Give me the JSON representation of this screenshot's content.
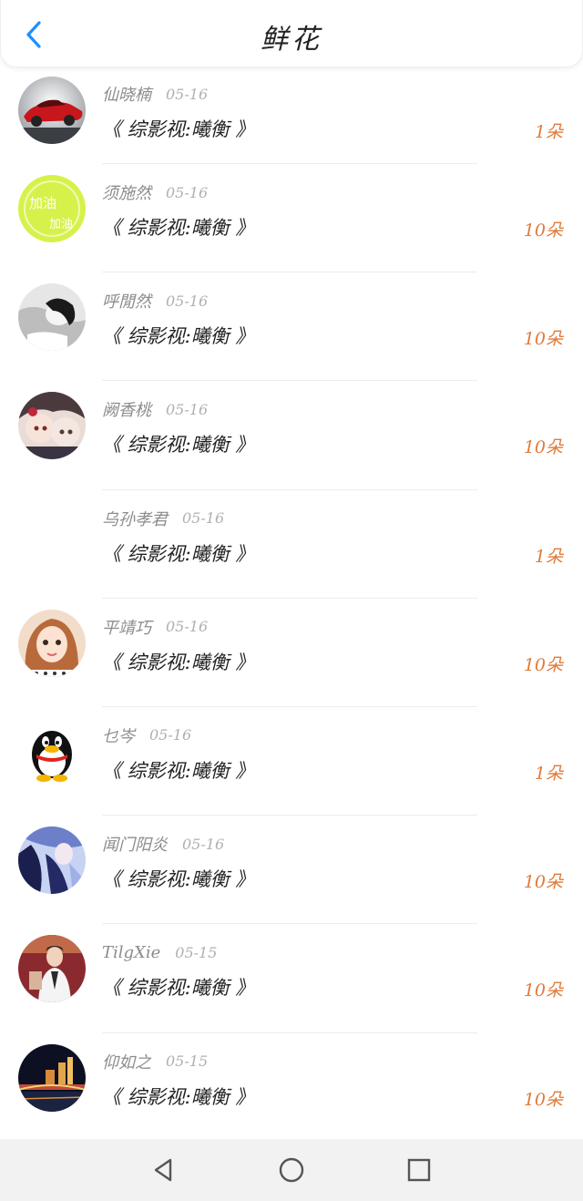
{
  "header": {
    "title": "鲜花",
    "back_icon": "chevron-left-icon"
  },
  "colors": {
    "accent": "#1e90ff",
    "amount": "#e07a3a",
    "name": "#8c8c8c"
  },
  "rows": [
    {
      "name": "仙晓楠",
      "date": "05-16",
      "message": "《 综影视:曦衡 》",
      "amount": "1朵",
      "avatar": "red-car"
    },
    {
      "name": "须施然",
      "date": "05-16",
      "message": "《 综影视:曦衡 》",
      "amount": "10朵",
      "avatar": "green-badge"
    },
    {
      "name": "呼閒然",
      "date": "05-16",
      "message": "《 综影视:曦衡 》",
      "amount": "10朵",
      "avatar": "bw-portrait"
    },
    {
      "name": "阙香桃",
      "date": "05-16",
      "message": "《 综影视:曦衡 》",
      "amount": "10朵",
      "avatar": "anime-pair"
    },
    {
      "name": "乌孙孝君",
      "date": "05-16",
      "message": "《 综影视:曦衡 》",
      "amount": "1朵",
      "avatar": "none"
    },
    {
      "name": "平靖巧",
      "date": "05-16",
      "message": "《 综影视:曦衡 》",
      "amount": "10朵",
      "avatar": "girl-photo"
    },
    {
      "name": "乜岑",
      "date": "05-16",
      "message": "《 综影视:曦衡 》",
      "amount": "1朵",
      "avatar": "penguin"
    },
    {
      "name": "闻门阳炎",
      "date": "05-16",
      "message": "《 综影视:曦衡 》",
      "amount": "10朵",
      "avatar": "anime-blue"
    },
    {
      "name": "TilgXie",
      "date": "05-15",
      "message": "《 综影视:曦衡 》",
      "amount": "10朵",
      "avatar": "man-photo"
    },
    {
      "name": "仰如之",
      "date": "05-15",
      "message": "《 综影视:曦衡 》",
      "amount": "10朵",
      "avatar": "city-night"
    }
  ],
  "navbar": {
    "back": "back-triangle-icon",
    "home": "home-circle-icon",
    "recents": "recents-square-icon"
  }
}
